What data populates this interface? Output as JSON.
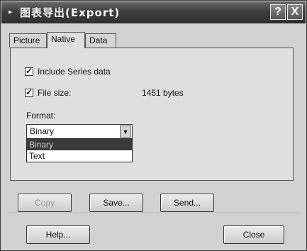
{
  "window": {
    "title": "图表导出(Export)"
  },
  "title_buttons": {
    "help": "?",
    "close": "X"
  },
  "tabs": [
    {
      "label": "Picture"
    },
    {
      "label": "Native"
    },
    {
      "label": "Data"
    }
  ],
  "native": {
    "include_series": {
      "label": "Include Series data",
      "checked": true
    },
    "file_size": {
      "label": "File size:",
      "checked": true,
      "value": "1451 bytes"
    },
    "format": {
      "label": "Format:",
      "selected": "Binary",
      "options": [
        "Binary",
        "Text"
      ]
    }
  },
  "actions": {
    "copy": "Copy",
    "save": "Save...",
    "send": "Send..."
  },
  "footer": {
    "help": "Help...",
    "close": "Close"
  }
}
